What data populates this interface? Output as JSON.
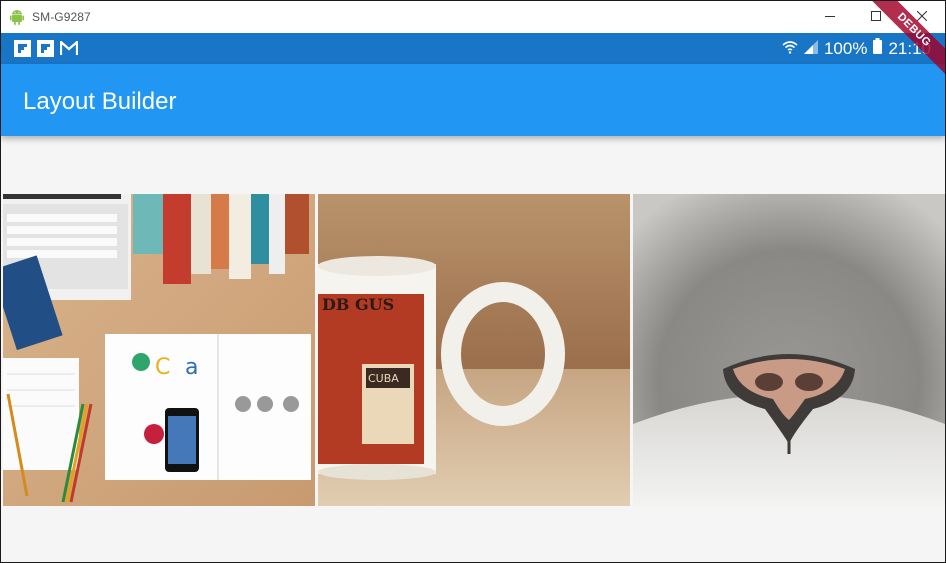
{
  "window": {
    "title": "SM-G9287",
    "icons": {
      "app": "android-icon",
      "minimize": "minimize-icon",
      "maximize": "maximize-icon",
      "close": "close-icon"
    }
  },
  "statusbar": {
    "left_icons": [
      "flipboard-icon",
      "flipboard-icon",
      "gmail-icon"
    ],
    "battery_percent": "100%",
    "time": "21:10",
    "right_icons": [
      "wifi-icon",
      "signal-icon",
      "battery-icon"
    ],
    "color": "#1976c6"
  },
  "appbar": {
    "title": "Layout Builder",
    "color": "#2196f3"
  },
  "debug_banner": {
    "label": "DEBUG"
  },
  "gallery": {
    "images": [
      {
        "description": "desk-flatlay-image"
      },
      {
        "description": "coffee-mug-image"
      },
      {
        "description": "cat-nose-image"
      }
    ]
  }
}
